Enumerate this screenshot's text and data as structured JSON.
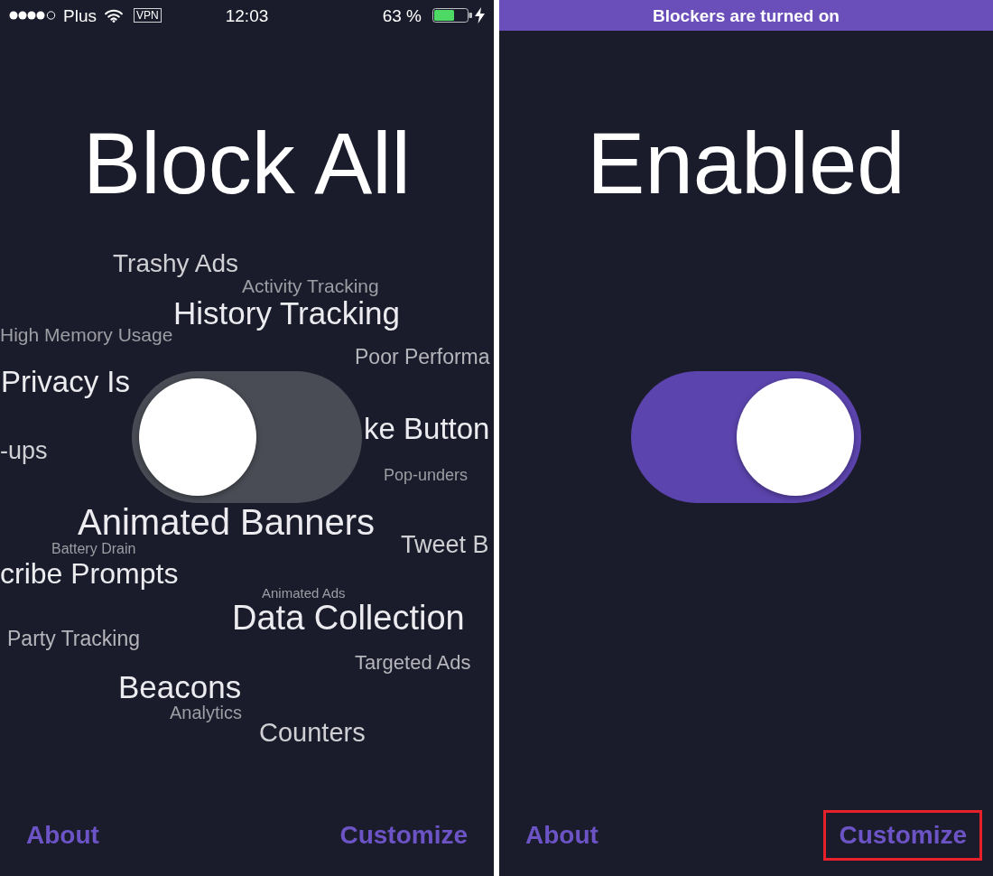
{
  "left_screen": {
    "status_bar": {
      "carrier": "Plus",
      "vpn": "VPN",
      "time": "12:03",
      "battery": "63 %"
    },
    "title": "Block All",
    "word_cloud": [
      "Trashy Ads",
      "Activity Tracking",
      "History Tracking",
      "High Memory Usage",
      "Poor Performa",
      "Privacy Is",
      "ke Button",
      "-ups",
      "Pop-unders",
      "Animated Banners",
      "Battery Drain",
      "Tweet B",
      "cribe Prompts",
      "Animated Ads",
      "Data Collection",
      "Party Tracking",
      "Targeted Ads",
      "Beacons",
      "Analytics",
      "Counters"
    ],
    "toggle": {
      "on": false
    },
    "footer": [
      {
        "label": "About",
        "highlighted": false
      },
      {
        "label": "Customize",
        "highlighted": false
      }
    ]
  },
  "right_screen": {
    "banner": "Blockers are turned on",
    "title": "Enabled",
    "toggle": {
      "on": true
    },
    "footer": [
      {
        "label": "About",
        "highlighted": false
      },
      {
        "label": "Customize",
        "highlighted": true
      }
    ]
  }
}
